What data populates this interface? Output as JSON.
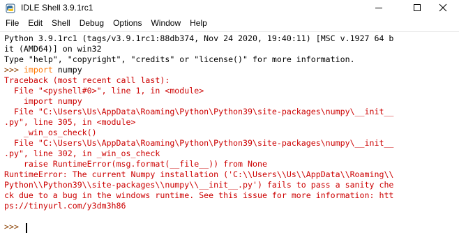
{
  "window": {
    "title": "IDLE Shell 3.9.1rc1",
    "controls": {
      "minimize_icon": "minimize-icon",
      "maximize_icon": "maximize-icon",
      "close_icon": "close-icon"
    }
  },
  "menu": {
    "items": [
      "File",
      "Edit",
      "Shell",
      "Debug",
      "Options",
      "Window",
      "Help"
    ]
  },
  "shell": {
    "banner": [
      "Python 3.9.1rc1 (tags/v3.9.1rc1:88db374, Nov 24 2020, 19:40:11) [MSC v.1927 64 b",
      "it (AMD64)] on win32",
      "Type \"help\", \"copyright\", \"credits\" or \"license()\" for more information."
    ],
    "prompt": ">>> ",
    "command_keyword": "import",
    "command_rest": " numpy",
    "traceback": [
      "Traceback (most recent call last):",
      "  File \"<pyshell#0>\", line 1, in <module>",
      "    import numpy",
      "  File \"C:\\Users\\Us\\AppData\\Roaming\\Python\\Python39\\site-packages\\numpy\\__init__",
      ".py\", line 305, in <module>",
      "    _win_os_check()",
      "  File \"C:\\Users\\Us\\AppData\\Roaming\\Python\\Python39\\site-packages\\numpy\\__init__",
      ".py\", line 302, in _win_os_check",
      "    raise RuntimeError(msg.format(__file__)) from None",
      "RuntimeError: The current Numpy installation ('C:\\\\Users\\\\Us\\\\AppData\\\\Roaming\\\\",
      "Python\\\\Python39\\\\site-packages\\\\numpy\\\\__init__.py') fails to pass a sanity che",
      "ck due to a bug in the windows runtime. See this issue for more information: htt",
      "ps://tinyurl.com/y3dm3h86"
    ],
    "final_prompt": ">>> "
  },
  "colors": {
    "error": "#cc0000",
    "prompt": "#8a4000",
    "keyword": "#ff7700",
    "text": "#000000"
  }
}
